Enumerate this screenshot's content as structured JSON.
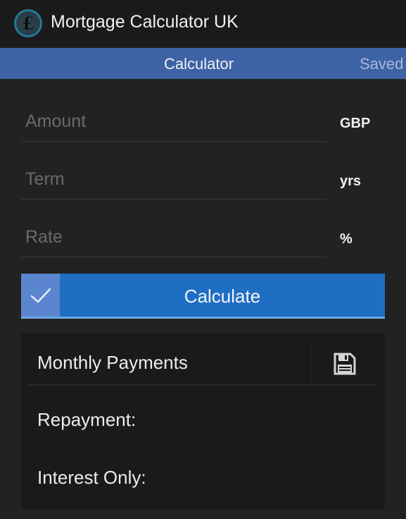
{
  "app": {
    "title": "Mortgage Calculator UK",
    "icon": "pound-coin-icon",
    "icon_glyph": "£"
  },
  "tabs": {
    "calculator": "Calculator",
    "saved": "Saved"
  },
  "form": {
    "amount": {
      "placeholder": "Amount",
      "value": "",
      "unit": "GBP"
    },
    "term": {
      "placeholder": "Term",
      "value": "",
      "unit": "yrs"
    },
    "rate": {
      "placeholder": "Rate",
      "value": "",
      "unit": "%"
    }
  },
  "calculate_button": {
    "label": "Calculate",
    "icon": "checkmark-icon"
  },
  "results": {
    "title": "Monthly Payments",
    "save_icon": "floppy-disk-icon",
    "repayment_label": "Repayment:",
    "interest_only_label": "Interest Only:"
  },
  "colors": {
    "background": "#222222",
    "titlebar": "#1a1a1a",
    "tabbar": "#3d62a6",
    "button": "#1e6fc4",
    "panel": "#1a1a1a"
  }
}
